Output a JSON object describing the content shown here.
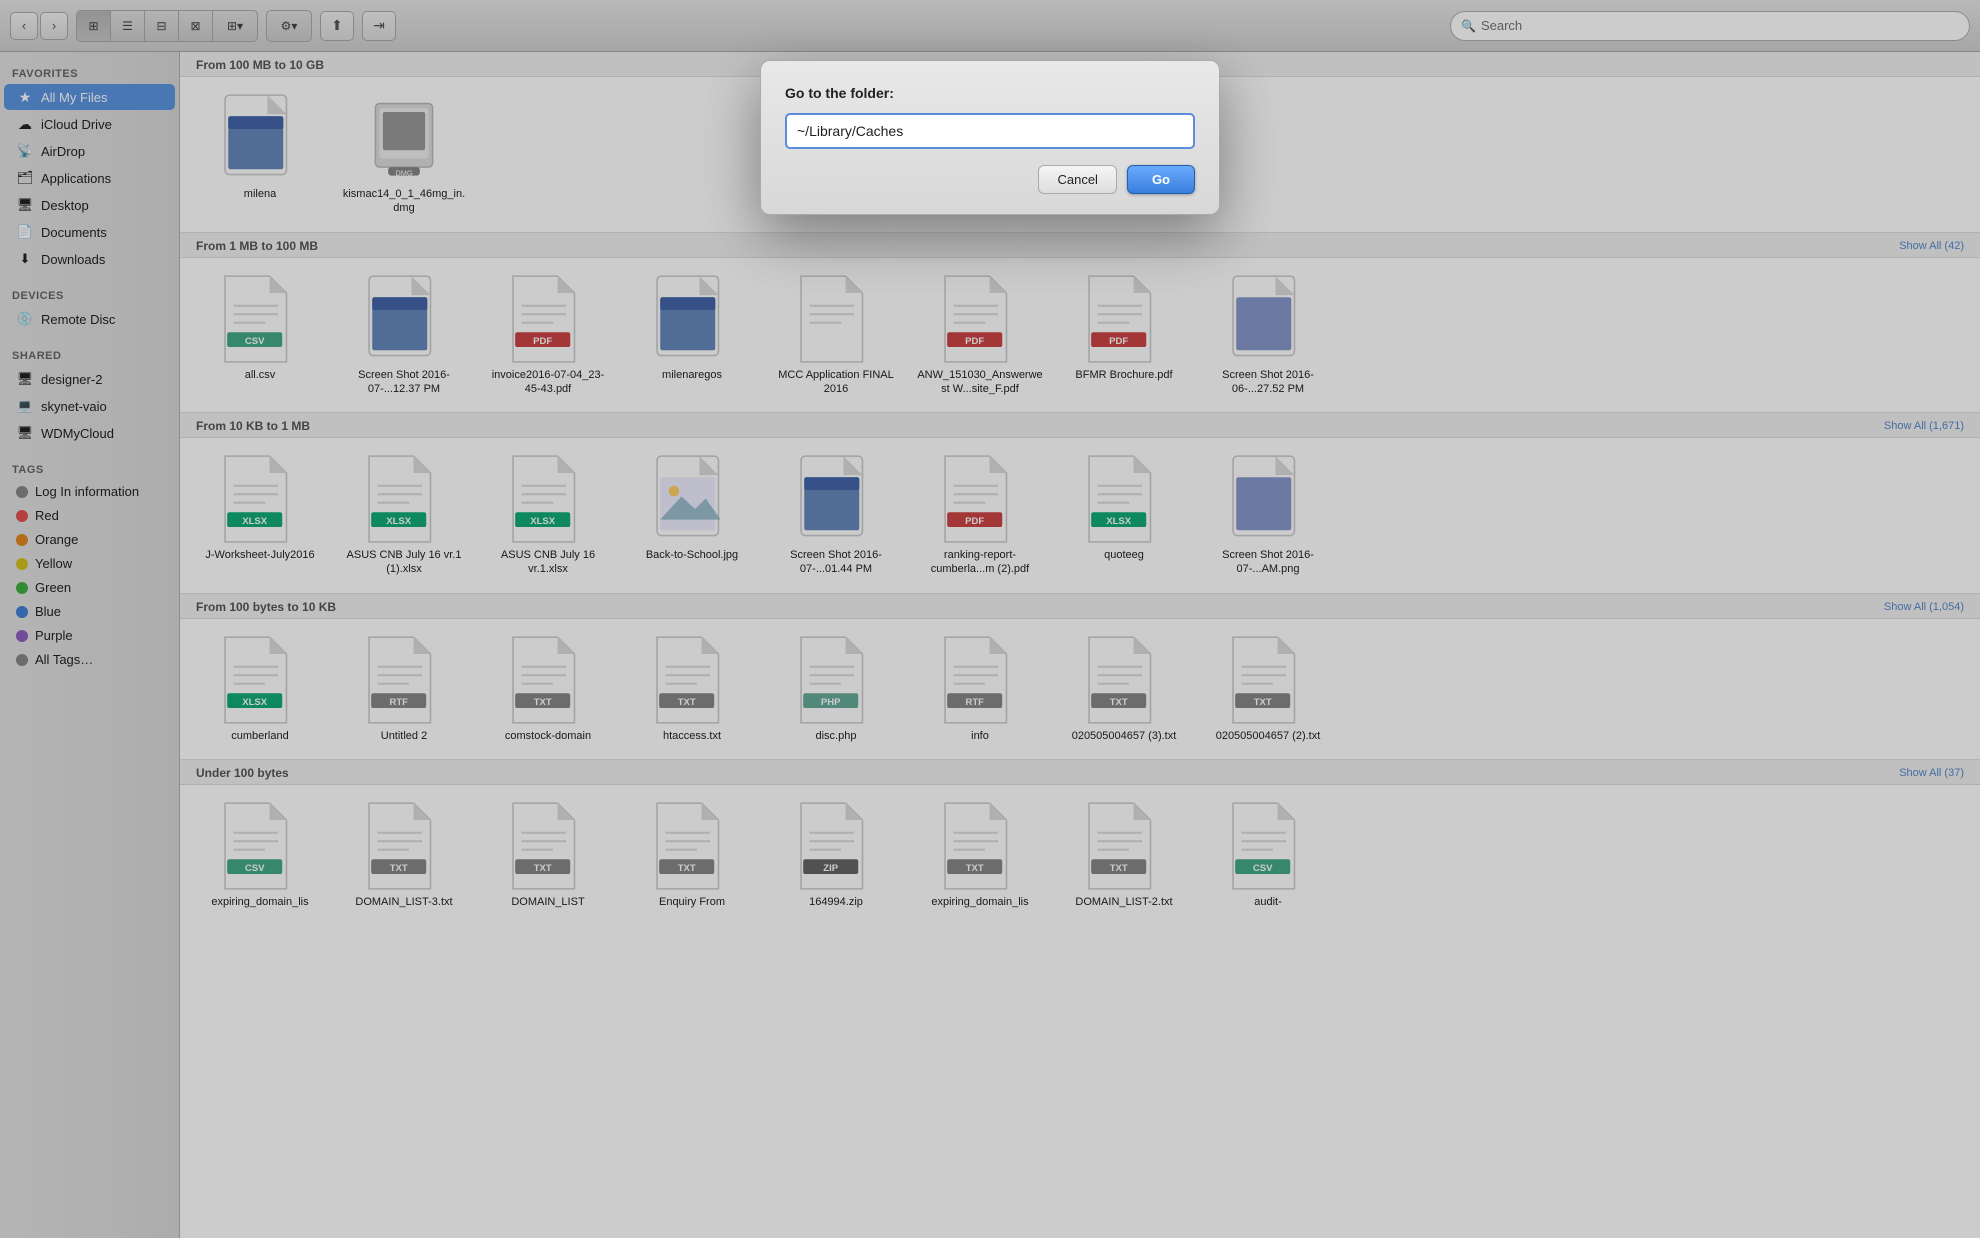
{
  "toolbar": {
    "back_label": "‹",
    "forward_label": "›",
    "view_icons": [
      "⊞",
      "☰",
      "⊟",
      "⊠"
    ],
    "action1": "⬆",
    "action2": "⇥",
    "search_placeholder": "Search",
    "search_label": "Search"
  },
  "sidebar": {
    "favorites_label": "Favorites",
    "items_favorites": [
      {
        "id": "all-my-files",
        "label": "All My Files",
        "icon": "★",
        "active": true
      },
      {
        "id": "icloud-drive",
        "label": "iCloud Drive",
        "icon": "☁"
      },
      {
        "id": "airdrop",
        "label": "AirDrop",
        "icon": "📡"
      },
      {
        "id": "applications",
        "label": "Applications",
        "icon": "🗂"
      },
      {
        "id": "desktop",
        "label": "Desktop",
        "icon": "🖥"
      },
      {
        "id": "documents",
        "label": "Documents",
        "icon": "📄"
      },
      {
        "id": "downloads",
        "label": "Downloads",
        "icon": "⬇"
      }
    ],
    "devices_label": "Devices",
    "items_devices": [
      {
        "id": "remote-disc",
        "label": "Remote Disc",
        "icon": "💿"
      }
    ],
    "shared_label": "Shared",
    "items_shared": [
      {
        "id": "designer-2",
        "label": "designer-2",
        "icon": "🖥"
      },
      {
        "id": "skynet-vaio",
        "label": "skynet-vaio",
        "icon": "💻"
      },
      {
        "id": "wdmycloud",
        "label": "WDMyCloud",
        "icon": "🖥"
      }
    ],
    "tags_label": "Tags",
    "items_tags": [
      {
        "id": "log-info",
        "label": "Log In information",
        "color": "#888"
      },
      {
        "id": "red",
        "label": "Red",
        "color": "#e05050"
      },
      {
        "id": "orange",
        "label": "Orange",
        "color": "#e08820"
      },
      {
        "id": "yellow",
        "label": "Yellow",
        "color": "#d4c020"
      },
      {
        "id": "green",
        "label": "Green",
        "color": "#40b040"
      },
      {
        "id": "blue",
        "label": "Blue",
        "color": "#4080d8"
      },
      {
        "id": "purple",
        "label": "Purple",
        "color": "#9060c0"
      },
      {
        "id": "all-tags",
        "label": "All Tags…",
        "color": "#888"
      }
    ]
  },
  "sections": [
    {
      "id": "100mb-10gb",
      "title": "From 100 MB to 10 GB",
      "show_all": "",
      "files": [
        {
          "name": "milena",
          "type": "screenshot",
          "ext": ""
        },
        {
          "name": "kismac14_0_1_46mg_in.dmg",
          "type": "dmg",
          "ext": ""
        }
      ]
    },
    {
      "id": "1mb-100mb",
      "title": "From 1 MB to 100 MB",
      "show_all": "Show All (42)",
      "files": [
        {
          "name": "all.csv",
          "type": "csv",
          "ext": "CSV"
        },
        {
          "name": "Screen Shot 2016-07-...12.37 PM",
          "type": "screenshot",
          "ext": ""
        },
        {
          "name": "invoice2016-07-04_23-45-43.pdf",
          "type": "pdf",
          "ext": "PDF"
        },
        {
          "name": "milenaregos",
          "type": "screenshot",
          "ext": ""
        },
        {
          "name": "MCC Application FINAL 2016",
          "type": "doc",
          "ext": ""
        },
        {
          "name": "ANW_151030_Answerwest W...site_F.pdf",
          "type": "pdf",
          "ext": "PDF"
        },
        {
          "name": "BFMR Brochure.pdf",
          "type": "pdf-color",
          "ext": "PDF"
        },
        {
          "name": "Screen Shot 2016-06-...27.52 PM",
          "type": "screenshot-partial",
          "ext": ""
        }
      ]
    },
    {
      "id": "10kb-1mb",
      "title": "From 10 KB to 1 MB",
      "show_all": "Show All (1,671)",
      "files": [
        {
          "name": "J-Worksheet-July2016",
          "type": "xlsx",
          "ext": "XLSX"
        },
        {
          "name": "ASUS CNB July 16 vr.1 (1).xlsx",
          "type": "xlsx",
          "ext": "XLSX"
        },
        {
          "name": "ASUS CNB July 16 vr.1.xlsx",
          "type": "xlsx",
          "ext": "XLSX"
        },
        {
          "name": "Back-to-School.jpg",
          "type": "image",
          "ext": ""
        },
        {
          "name": "Screen Shot 2016-07-...01.44 PM",
          "type": "screenshot2",
          "ext": ""
        },
        {
          "name": "ranking-report-cumberla...m (2).pdf",
          "type": "pdf",
          "ext": "PDF"
        },
        {
          "name": "quoteeg",
          "type": "xlsx",
          "ext": "XLSX"
        },
        {
          "name": "Screen Shot 2016-07-...AM.png",
          "type": "screenshot-partial",
          "ext": ""
        }
      ]
    },
    {
      "id": "100b-10kb",
      "title": "From 100 bytes to 10 KB",
      "show_all": "Show All (1,054)",
      "files": [
        {
          "name": "cumberland",
          "type": "xlsx-s",
          "ext": "XLSX"
        },
        {
          "name": "Untitled 2",
          "type": "rtf",
          "ext": "RTF"
        },
        {
          "name": "comstock-domain",
          "type": "txt",
          "ext": "TXT"
        },
        {
          "name": "htaccess.txt",
          "type": "txt",
          "ext": "TXT"
        },
        {
          "name": "disc.php",
          "type": "php",
          "ext": "PHP"
        },
        {
          "name": "info",
          "type": "rtf",
          "ext": "RTF"
        },
        {
          "name": "020505004657 (3).txt",
          "type": "txt",
          "ext": "TXT"
        },
        {
          "name": "020505004657 (2).txt",
          "type": "txt",
          "ext": "TXT"
        }
      ]
    },
    {
      "id": "under-100b",
      "title": "Under 100 bytes",
      "show_all": "Show All (37)",
      "files": [
        {
          "name": "expiring_domain_lis",
          "type": "csv",
          "ext": "CSV"
        },
        {
          "name": "DOMAIN_LIST-3.txt",
          "type": "txt",
          "ext": "TXT"
        },
        {
          "name": "DOMAIN_LIST",
          "type": "txt",
          "ext": "TXT"
        },
        {
          "name": "Enquiry From",
          "type": "txt",
          "ext": "TXT"
        },
        {
          "name": "164994.zip",
          "type": "zip",
          "ext": "ZIP"
        },
        {
          "name": "expiring_domain_lis",
          "type": "txt",
          "ext": "TXT"
        },
        {
          "name": "DOMAIN_LIST-2.txt",
          "type": "txt",
          "ext": "TXT"
        },
        {
          "name": "audit-",
          "type": "csv",
          "ext": "CSV"
        }
      ]
    }
  ],
  "dialog": {
    "title": "Go to the folder:",
    "input_value": "~/Library/Caches",
    "cancel_label": "Cancel",
    "go_label": "Go"
  }
}
